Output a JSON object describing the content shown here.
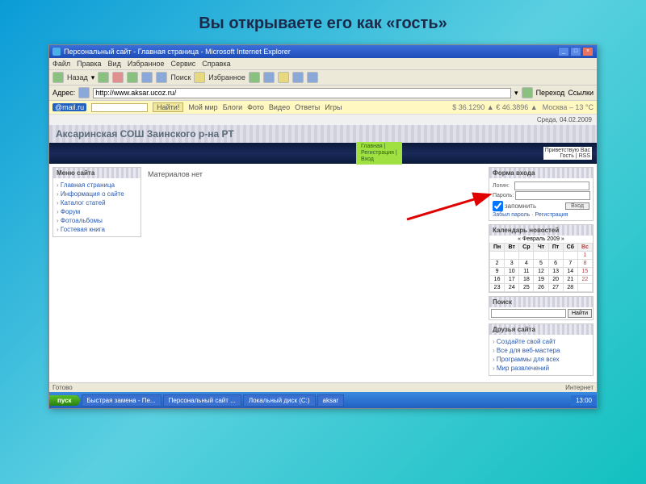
{
  "slide_title": "Вы открываете его как «гость»",
  "titlebar": {
    "text": "Персональный сайт - Главная страница - Microsoft Internet Explorer"
  },
  "menubar": [
    "Файл",
    "Правка",
    "Вид",
    "Избранное",
    "Сервис",
    "Справка"
  ],
  "toolbar": {
    "back": "Назад",
    "search": "Поиск",
    "fav": "Избранное"
  },
  "addr": {
    "label": "Адрес:",
    "url": "http://www.aksar.ucoz.ru/",
    "go": "Переход",
    "links": "Ссылки"
  },
  "mailbar": {
    "logo": "@mail.ru",
    "btn": "Найти!",
    "items": [
      "Мой мир",
      "Блоги",
      "Фото",
      "Видео",
      "Ответы",
      "Игры"
    ],
    "stock": "$ 36.1290 ▲ € 46.3896 ▲",
    "weather": "Москва – 13 °C"
  },
  "date": "Среда, 04.02.2009",
  "site_header": "Аксаринская СОШ Заинского р-на РТ",
  "greenlinks": "Главная |\nРегистрация |\nВход",
  "greeting": "Приветствую Вас\nГость | RSS",
  "menu": {
    "title": "Меню сайта",
    "items": [
      "Главная страница",
      "Информация о сайте",
      "Каталог статей",
      "Форум",
      "Фотоальбомы",
      "Гостевая книга"
    ]
  },
  "main_empty": "Материалов нет",
  "login": {
    "title": "Форма входа",
    "login_lbl": "Логин:",
    "pass_lbl": "Пароль:",
    "remember": "запомнить",
    "forgot": "Забыл пароль",
    "reg": "Регистрация",
    "btn": "Вход"
  },
  "calendar": {
    "title": "Календарь новостей",
    "nav": "« Февраль 2009 »",
    "days": [
      "Пн",
      "Вт",
      "Ср",
      "Чт",
      "Пт",
      "Сб",
      "Вс"
    ],
    "rows": [
      [
        "",
        "",
        "",
        "",
        "",
        "",
        "1"
      ],
      [
        "2",
        "3",
        "4",
        "5",
        "6",
        "7",
        "8"
      ],
      [
        "9",
        "10",
        "11",
        "12",
        "13",
        "14",
        "15"
      ],
      [
        "16",
        "17",
        "18",
        "19",
        "20",
        "21",
        "22"
      ],
      [
        "23",
        "24",
        "25",
        "26",
        "27",
        "28",
        ""
      ]
    ]
  },
  "search": {
    "title": "Поиск",
    "btn": "Найти"
  },
  "friends": {
    "title": "Друзья сайта",
    "items": [
      "Создайте свой сайт",
      "Все для веб-мастера",
      "Программы для всех",
      "Мир развлечений"
    ]
  },
  "status": {
    "ready": "Готово",
    "net": "Интернет"
  },
  "taskbar": {
    "start": "пуск",
    "items": [
      "Быстрая замена - Пе...",
      "Персональный сайт ...",
      "Локальный диск (C:)",
      "aksar"
    ],
    "time": "13:00"
  }
}
